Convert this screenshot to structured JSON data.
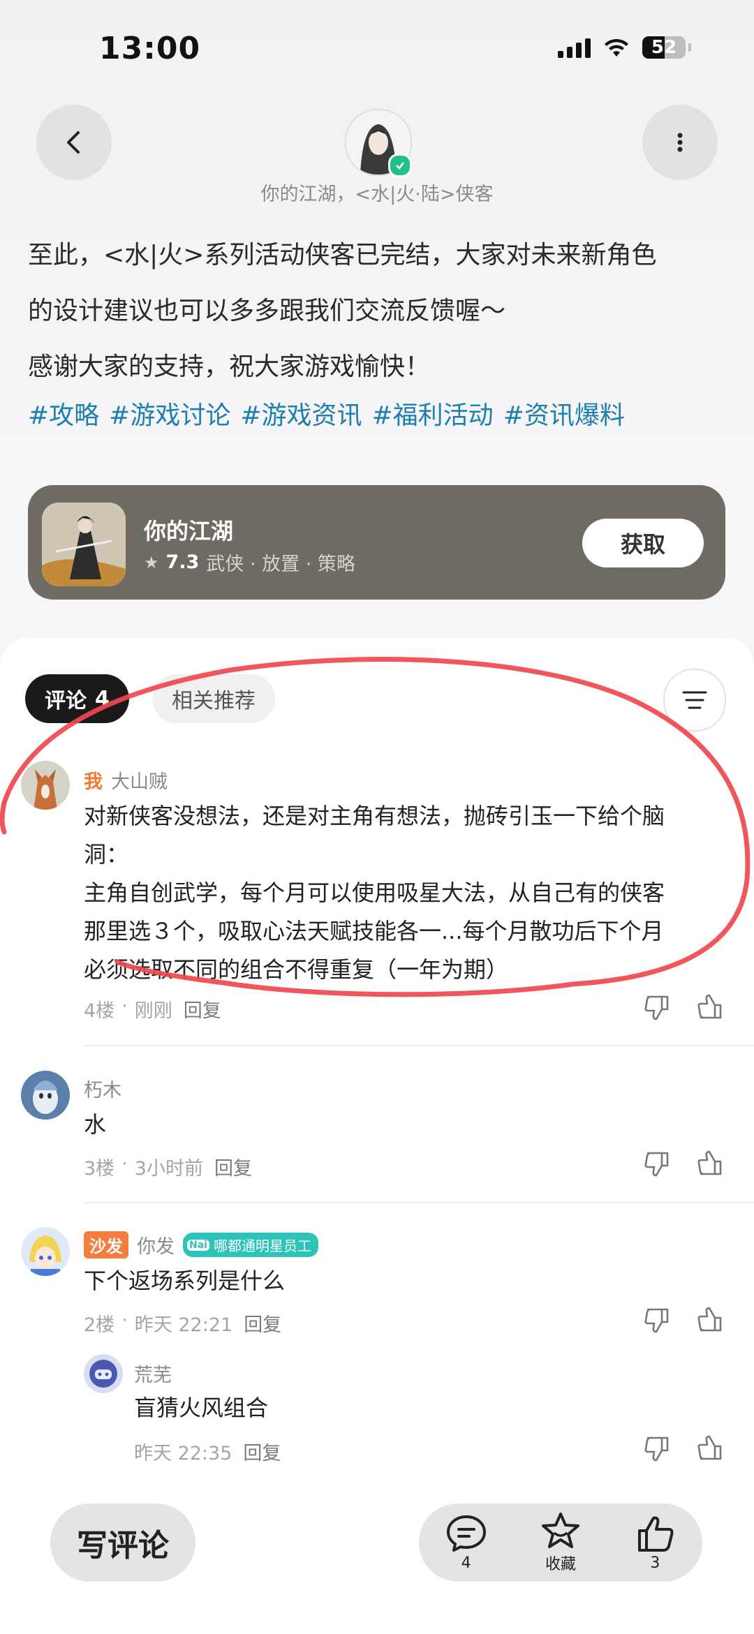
{
  "status_bar": {
    "time": "13:00",
    "battery": "52"
  },
  "header": {
    "author_name": "你的江湖，<水|火·陆>侠客"
  },
  "post": {
    "lines": [
      "至此，<水|火>系列活动侠客已完结，大家对未来新角色",
      "的设计建议也可以多多跟我们交流反馈喔～",
      "感谢大家的支持，祝大家游戏愉快！"
    ],
    "tags": [
      "#攻略",
      "#游戏讨论",
      "#游戏资讯",
      "#福利活动",
      "#资讯爆料"
    ]
  },
  "game_card": {
    "name": "你的江湖",
    "score": "7.3",
    "genres": "武侠 · 放置 · 策略",
    "get_label": "获取"
  },
  "tabs": {
    "comments_label": "评论",
    "comments_count": "4",
    "related_label": "相关推荐"
  },
  "comments": [
    {
      "me_label": "我",
      "user": "大山贼",
      "lines": [
        "对新侠客没想法，还是对主角有想法，抛砖引玉一下给个脑",
        "洞：",
        "主角自创武学，每个月可以使用吸星大法，从自己有的侠客",
        "那里选３个，吸取心法天赋技能各一...每个月散功后下个月",
        "必须选取不同的组合不得重复（一年为期）"
      ],
      "floor": "4楼",
      "time": "刚刚",
      "reply": "回复"
    },
    {
      "user": "朽木",
      "text": "水",
      "floor": "3楼",
      "time": "3小时前",
      "reply": "回复"
    },
    {
      "sofa_label": "沙发",
      "user": "你发",
      "badge_mark": "Nai",
      "badge": "哪都通明星员工",
      "text": "下个返场系列是什么",
      "floor": "2楼",
      "time": "昨天 22:21",
      "reply": "回复",
      "sub_reply": {
        "user": "荒芜",
        "text": "盲猜火风组合",
        "time": "昨天 22:35",
        "reply": "回复"
      }
    }
  ],
  "bottom_bar": {
    "write_label": "写评论",
    "comment_count": "4",
    "favorite_label": "收藏",
    "like_count": "3"
  },
  "colors": {
    "accent_blue": "#1e7fae",
    "annotation_red": "#f0484e",
    "me_tag": "#f07a2e",
    "sofa": "#f47c3c",
    "staff_badge": "#2cc4b8",
    "card_bg": "#6f6a62"
  }
}
